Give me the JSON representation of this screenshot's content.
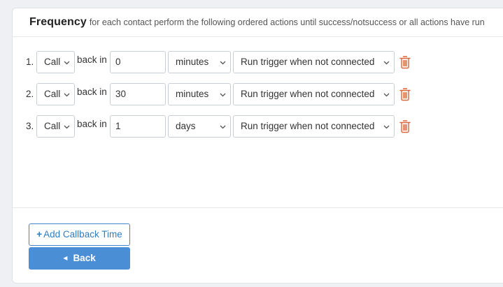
{
  "header": {
    "title": "Frequency",
    "subtitle": "for each contact perform the following ordered actions until success/notsuccess or all actions have run"
  },
  "rows": [
    {
      "number": "1.",
      "action": "Call",
      "back_in_label": "back in",
      "amount": "0",
      "unit": "minutes",
      "trigger": "Run trigger when not connected"
    },
    {
      "number": "2.",
      "action": "Call",
      "back_in_label": "back in",
      "amount": "30",
      "unit": "minutes",
      "trigger": "Run trigger when not connected"
    },
    {
      "number": "3.",
      "action": "Call",
      "back_in_label": "back in",
      "amount": "1",
      "unit": "days",
      "trigger": "Run trigger when not connected"
    }
  ],
  "buttons": {
    "add_callback": "Add Callback Time",
    "back": "Back"
  },
  "icons": {
    "delete": "trash-icon",
    "dropdown": "chevron-down-icon",
    "add": "plus-icon",
    "back": "caret-left-icon"
  },
  "colors": {
    "accent": "#4a8fd6",
    "link": "#2f7cc1",
    "delete": "#d9663a"
  }
}
